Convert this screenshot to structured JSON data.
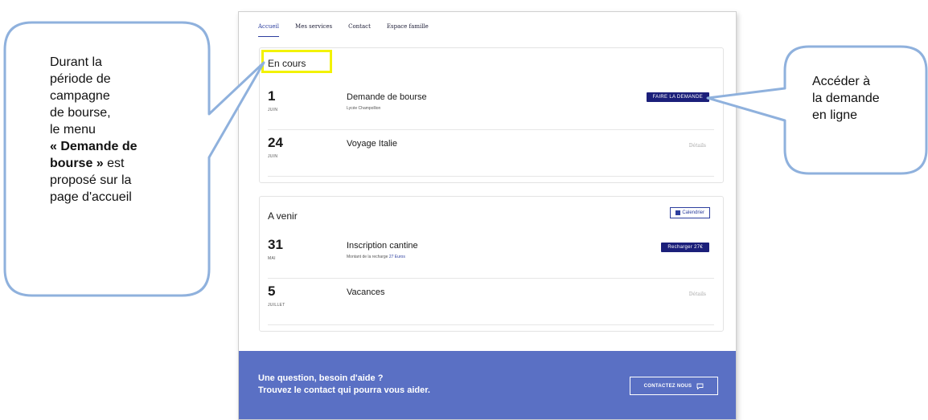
{
  "tabs": [
    "Accueil",
    "Mes services",
    "Contact",
    "Espace famille"
  ],
  "en_cours": {
    "title": "En cours",
    "rows": [
      {
        "day": "1",
        "month": "JUIN",
        "event": "Demande de bourse",
        "sub": "Lycée Champollion",
        "action": "FAIRE LA DEMANDE"
      },
      {
        "day": "24",
        "month": "JUIN",
        "event": "Voyage Italie",
        "action": "Détails"
      }
    ]
  },
  "a_venir": {
    "title": "A venir",
    "calendar_btn": "Calendrier",
    "rows": [
      {
        "day": "31",
        "month": "MAI",
        "event": "Inscription cantine",
        "sub": "Montant de la recharge",
        "sub_link": "27 Euros",
        "action": "Recharger 27€"
      },
      {
        "day": "5",
        "month": "JUILLET",
        "event": "Vacances",
        "action": "Détails"
      }
    ]
  },
  "footer": {
    "line1": "Une question, besoin d'aide ?",
    "line2": "Trouvez le contact qui pourra vous aider.",
    "contact_btn": "CONTACTEZ NOUS"
  },
  "callout_left": {
    "line1": "Durant la",
    "line2": "période de",
    "line3": "campagne",
    "line4": "de bourse,",
    "line5": "le menu",
    "bold1": "« Demande de",
    "bold2": "bourse »",
    "line6": " est",
    "line7": "proposé sur la",
    "line8": "page d'accueil"
  },
  "callout_right": {
    "line1": "Accéder à",
    "line2": "la demande",
    "line3": "en ligne"
  },
  "colors": {
    "accent": "#1b1f7a",
    "footer": "#5a70c4",
    "highlight": "#f2f200",
    "callout_border": "#8fb1dd"
  }
}
